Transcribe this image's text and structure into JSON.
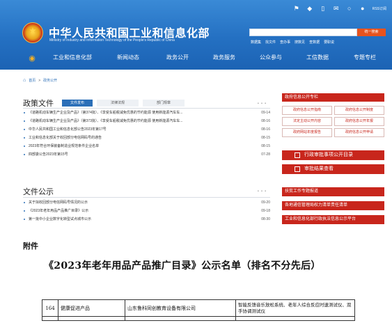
{
  "header": {
    "site_title": "中华人民共和国工业和信息化部",
    "site_subtitle": "Ministry of Industry and Information Technology of the People's Republic of China",
    "rss_label": "RSS订阅",
    "search_placeholder": "",
    "search_button": "统一搜索",
    "quick_links": [
      "数据集",
      "找文件",
      "查办事",
      "搜数见",
      "查数据",
      "要职说"
    ],
    "icons": [
      "shield-icon",
      "sign-icon",
      "mobile-icon",
      "mail-icon",
      "wechat-icon",
      "weibo-icon"
    ]
  },
  "nav": {
    "items": [
      "工业和信息化部",
      "新闻动态",
      "政务公开",
      "政务服务",
      "公众参与",
      "工信数据",
      "专题专栏"
    ]
  },
  "breadcrumb": {
    "home": "首页",
    "separator": ">",
    "current": "政务公开"
  },
  "policy": {
    "title": "政策文件",
    "tabs": [
      "文件发布",
      "法律法规",
      "部门规章"
    ],
    "more": "• • •",
    "items": [
      {
        "text": "《道路机动车辆生产企业及产品》（第374批）、《享受车船税减免优惠的节约能源 使用新能源汽车车...",
        "date": "09-14"
      },
      {
        "text": "《道路机动车辆生产企业及产品》（第373批）、《享受车船税减免优惠的节约能源 使用新能源汽车车...",
        "date": "08-16"
      },
      {
        "text": "中华人民共和国工业和信息化部公告2023年第17号",
        "date": "08-16"
      },
      {
        "text": "工业和信息化部关于收回部分电信网码号的通告",
        "date": "08-15"
      },
      {
        "text": "2023年符合环保装备制造业规范条件企业名单",
        "date": "08-15"
      },
      {
        "text": "四部委公告2023年第15号",
        "date": "07-28"
      }
    ]
  },
  "notice": {
    "title": "文件公示",
    "more": "• • •",
    "items": [
      {
        "text": "关于拟收回部分电信网码号情况的公示",
        "date": "09-20"
      },
      {
        "text": "《2023年老年用品产品推广目录》公示",
        "date": "09-18"
      },
      {
        "text": "第一批中小企业数字化转型试点城市公示",
        "date": "08-30"
      }
    ]
  },
  "sidebar": {
    "head": "政府信息公开专栏",
    "grid": [
      "政府信息公开指南",
      "政府信息公开制度",
      "法定主动公开内容",
      "政府信息公开年报",
      "政府网站年度报告",
      "政府信息公开申请"
    ],
    "bar1": "行政审批事项公开目录",
    "bar2": "审批结果查看",
    "links": [
      "扶贫工作专题报道",
      "各地通信管理局权力清单责任清单",
      "工业和信息化部行政执法信息公示平台"
    ]
  },
  "document": {
    "attachment_label": "附件",
    "title": "《2023年老年用品产品推广目录》公示名单（排名不分先后）",
    "row": {
      "no": "164",
      "category": "健康促进产品",
      "company": "山东鲁科同创教育设备有限公司",
      "product": "智能反馈音乐放松系统、老年人综合反应时速测试仪、双手协调测试仪"
    }
  },
  "colors": {
    "header_blue": "#2470c2",
    "accent_red": "#c8261c",
    "link_blue": "#2b6fb8",
    "search_orange": "#e8531d"
  }
}
